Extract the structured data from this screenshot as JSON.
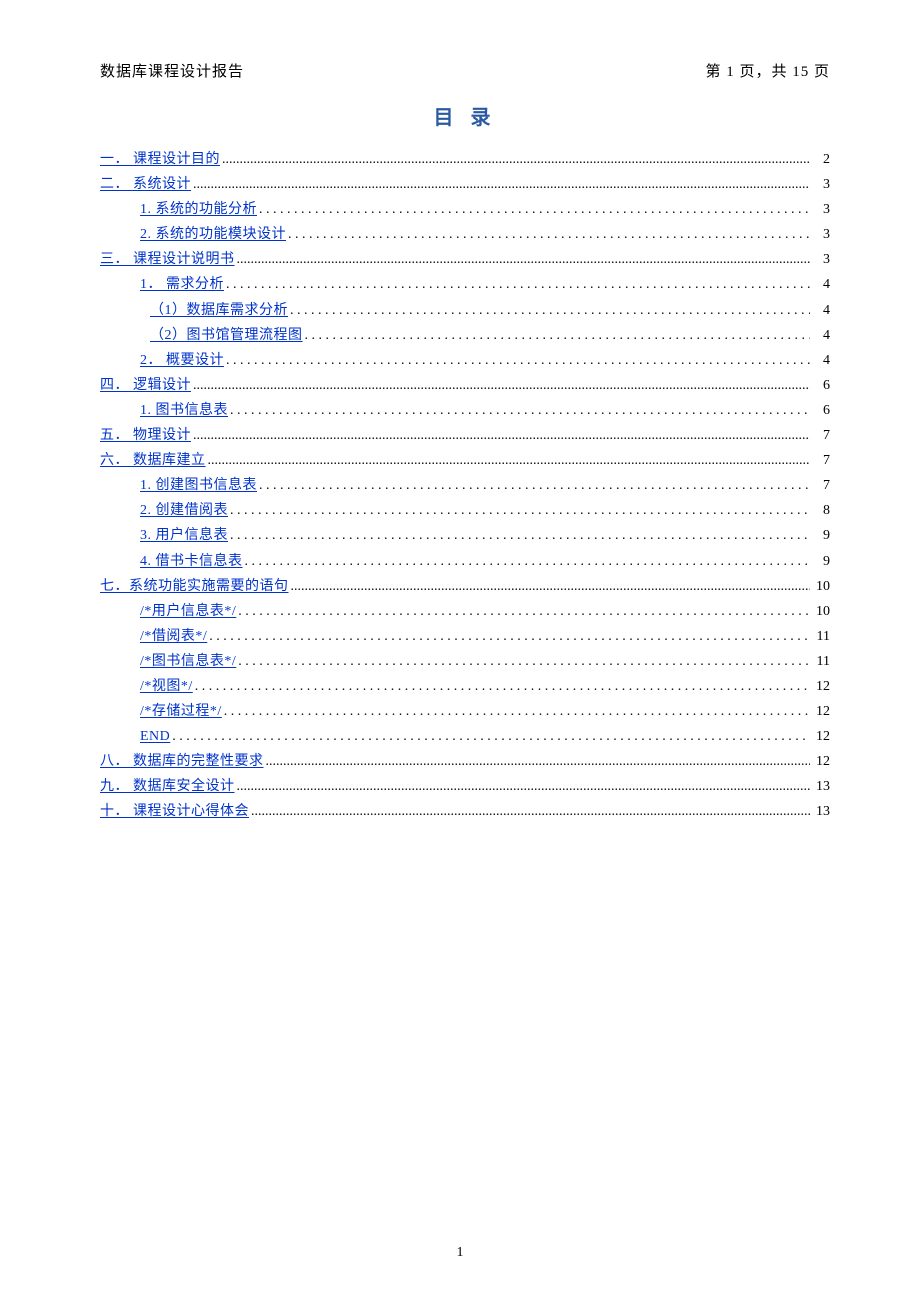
{
  "header": {
    "left": "数据库课程设计报告",
    "right": "第  1  页，共 15 页"
  },
  "title": "目 录",
  "footer_page": "1",
  "leader_dense": "........................................................................................................................................................................................................................................................................",
  "leader_sparse": ". . . . . . . . . . . . . . . . . . . . . . . . . . . . . . . . . . . . . . . . . . . . . . . . . . . . . . . . . . . . . . . . . . . . . . . . . . . . . . . . . . . . . . . . . . . . . . . . . . . . . . . . . . . . . . . . . . . . . . . . . . . . . . . . . . . . . . . . . .",
  "toc": [
    {
      "level": 0,
      "label": "一． 课程设计目的",
      "page": "2",
      "style": "dense"
    },
    {
      "level": 0,
      "label": "二． 系统设计",
      "page": "3",
      "style": "dense"
    },
    {
      "level": 1,
      "label": "1. 系统的功能分析",
      "page": "3",
      "style": "sparse"
    },
    {
      "level": 1,
      "label": "2. 系统的功能模块设计",
      "page": "3",
      "style": "sparse"
    },
    {
      "level": 0,
      "label": "三． 课程设计说明书",
      "page": "3",
      "style": "dense"
    },
    {
      "level": 1,
      "label": "1． 需求分析",
      "page": "4",
      "style": "sparse"
    },
    {
      "level": 2,
      "label": "（1）数据库需求分析",
      "page": "4",
      "style": "sparse"
    },
    {
      "level": 2,
      "label": "（2）图书馆管理流程图",
      "page": "4",
      "style": "sparse"
    },
    {
      "level": 1,
      "label": "2． 概要设计",
      "page": "4",
      "style": "sparse"
    },
    {
      "level": 0,
      "label": "四． 逻辑设计",
      "page": "6",
      "style": "dense"
    },
    {
      "level": 1,
      "label": "1. 图书信息表",
      "page": "6",
      "style": "sparse"
    },
    {
      "level": 0,
      "label": "五． 物理设计",
      "page": "7",
      "style": "dense"
    },
    {
      "level": 0,
      "label": "六． 数据库建立",
      "page": "7",
      "style": "dense"
    },
    {
      "level": 1,
      "label": "1. 创建图书信息表",
      "page": "7",
      "style": "sparse"
    },
    {
      "level": 1,
      "label": "2. 创建借阅表",
      "page": "8",
      "style": "sparse"
    },
    {
      "level": 1,
      "label": "3. 用户信息表",
      "page": "9",
      "style": "sparse"
    },
    {
      "level": 1,
      "label": "4. 借书卡信息表",
      "page": "9",
      "style": "sparse"
    },
    {
      "level": 0,
      "label": "七．系统功能实施需要的语句",
      "page": "10",
      "style": "dense"
    },
    {
      "level": 1,
      "label": "/*用户信息表*/",
      "page": "10",
      "style": "sparse"
    },
    {
      "level": 1,
      "label": "/*借阅表*/",
      "page": "11",
      "style": "sparse"
    },
    {
      "level": 1,
      "label": "/*图书信息表*/",
      "page": "11",
      "style": "sparse"
    },
    {
      "level": 1,
      "label": "/*视图*/",
      "page": "12",
      "style": "sparse"
    },
    {
      "level": 1,
      "label": "/*存储过程*/",
      "page": "12",
      "style": "sparse"
    },
    {
      "level": 1,
      "label": "END",
      "page": "12",
      "style": "sparse"
    },
    {
      "level": 0,
      "label": "八． 数据库的完整性要求",
      "page": "12",
      "style": "dense"
    },
    {
      "level": 0,
      "label": "九． 数据库安全设计",
      "page": "13",
      "style": "dense"
    },
    {
      "level": 0,
      "label": "十． 课程设计心得体会",
      "page": "13",
      "style": "dense"
    }
  ]
}
